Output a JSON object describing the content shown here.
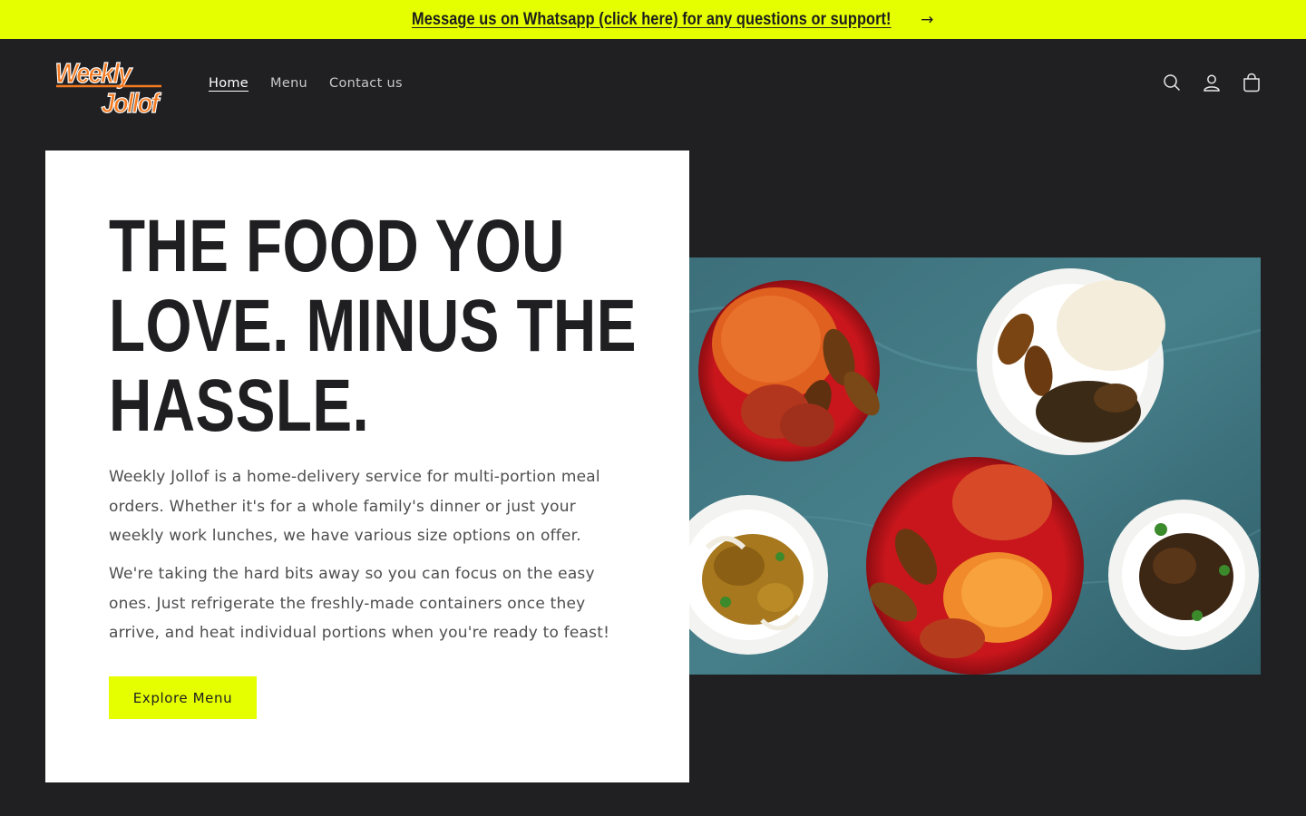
{
  "announcement": {
    "text": "Message us on Whatsapp (click here) for any questions or support!",
    "arrow": "→"
  },
  "header": {
    "logo_alt": "Weekly Jollof",
    "nav": [
      "Home",
      "Menu",
      "Contact us"
    ],
    "icons": [
      "search-icon",
      "account-icon",
      "cart-icon"
    ]
  },
  "hero": {
    "title_lines": [
      "THE FOOD YOU",
      "LOVE. MINUS THE",
      "HASSLE."
    ],
    "paragraph1": "Weekly Jollof is a home-delivery service for multi-portion meal orders. Whether it's for a whole family's dinner or just your weekly work lunches, we have various size options on offer.",
    "paragraph2": "We're taking the hard bits away so you can focus on the easy ones. Just refrigerate the freshly-made containers once they arrive, and heat individual portions when you're ready to feast!",
    "cta": "Explore Menu"
  },
  "colors": {
    "accent": "#e5ff00",
    "background": "#202023",
    "logo_orange": "#f47a20"
  }
}
